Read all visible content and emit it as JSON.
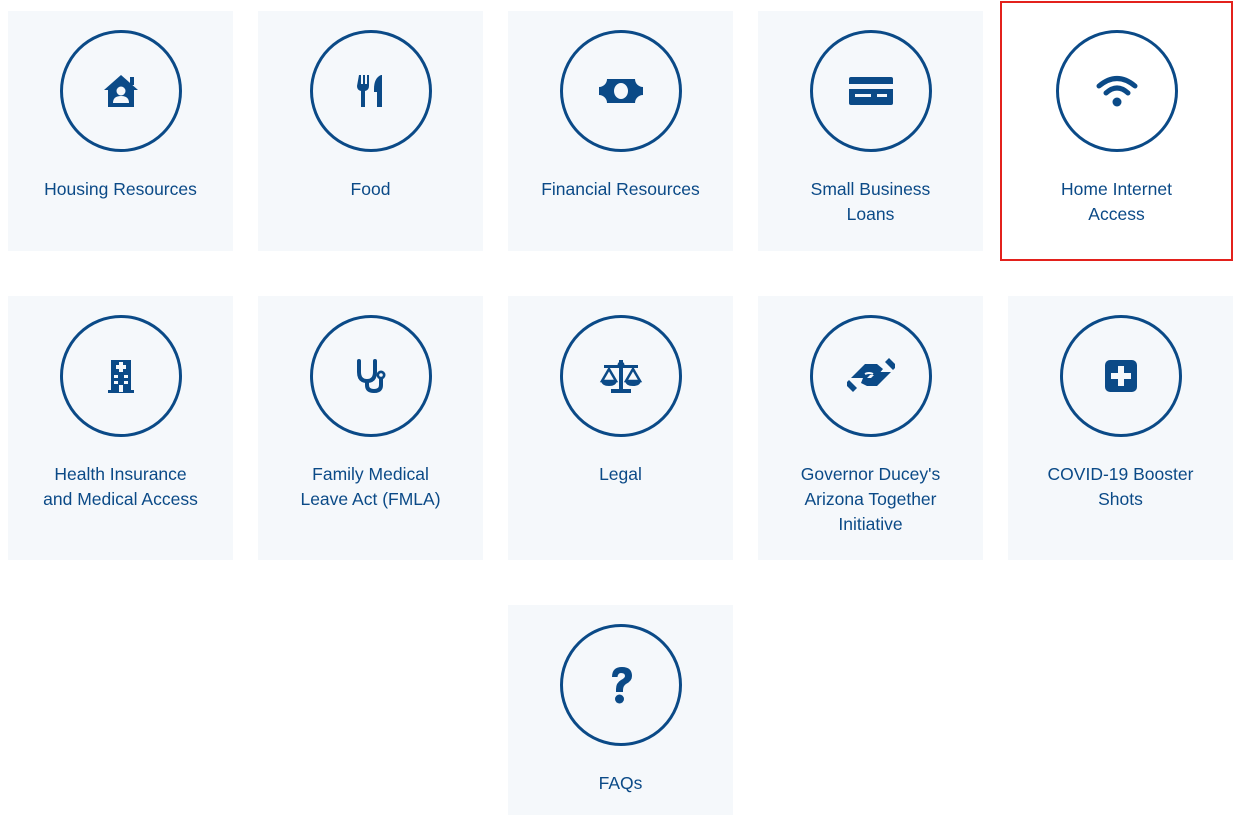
{
  "tiles": [
    {
      "label": "Housing Resources",
      "icon": "house-person-icon"
    },
    {
      "label": "Food",
      "icon": "utensils-icon"
    },
    {
      "label": "Financial Resources",
      "icon": "money-bill-icon"
    },
    {
      "label": "Small Business\nLoans",
      "icon": "credit-card-icon"
    },
    {
      "label": "Home Internet\nAccess",
      "icon": "wifi-icon",
      "selected": true
    },
    {
      "label": "Health Insurance\nand Medical Access",
      "icon": "hospital-icon"
    },
    {
      "label": "Family Medical\nLeave Act (FMLA)",
      "icon": "stethoscope-icon"
    },
    {
      "label": "Legal",
      "icon": "balance-scale-icon"
    },
    {
      "label": "Governor Ducey's\nArizona Together\nInitiative",
      "icon": "handshake-icon"
    },
    {
      "label": "COVID-19 Booster\nShots",
      "icon": "medical-plus-icon"
    },
    {
      "label": "FAQs",
      "icon": "question-icon"
    }
  ],
  "colors": {
    "primary": "#0b4a87",
    "tile_bg": "#f5f8fb",
    "selected_outline": "#e3211c"
  }
}
